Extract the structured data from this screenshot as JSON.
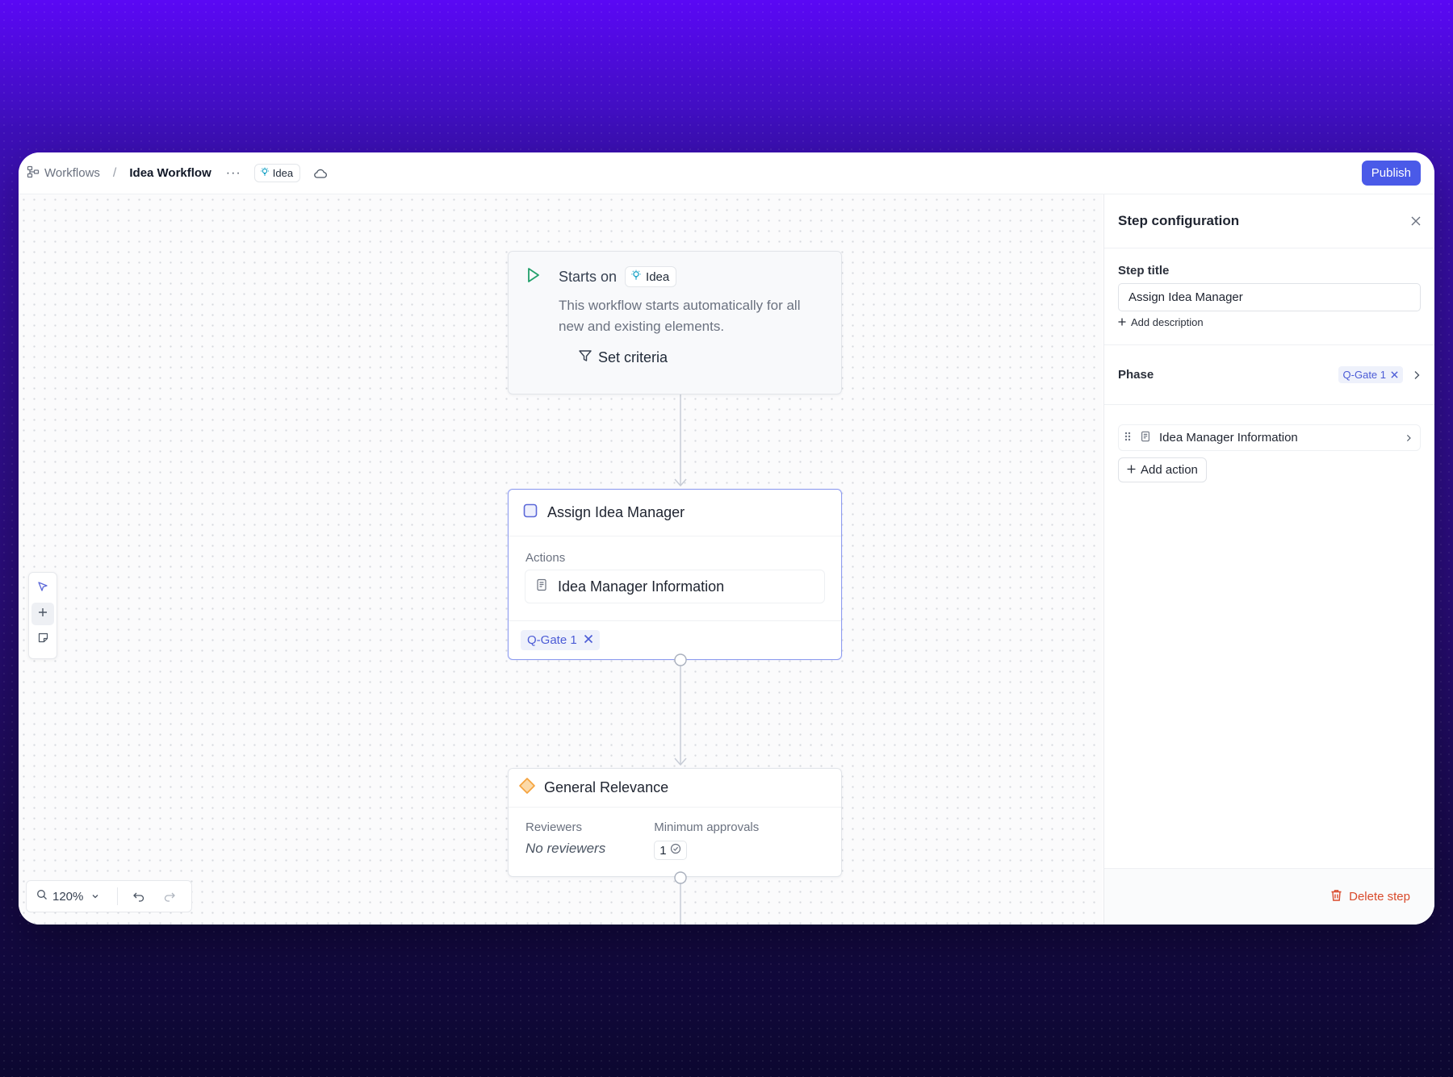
{
  "header": {
    "breadcrumb_root": "Workflows",
    "breadcrumb_separator": "/",
    "breadcrumb_current": "Idea Workflow",
    "more_label": "···",
    "type_label": "Idea",
    "publish_label": "Publish"
  },
  "start_node": {
    "title": "Starts on",
    "chip_label": "Idea",
    "description": "This workflow starts automatically for all new and existing elements.",
    "criteria_label": "Set criteria"
  },
  "assign_node": {
    "title": "Assign Idea Manager",
    "actions_label": "Actions",
    "action_item": "Idea Manager Information",
    "gate_label": "Q-Gate 1"
  },
  "relevance_node": {
    "title": "General Relevance",
    "reviewers_label": "Reviewers",
    "reviewers_value": "No reviewers",
    "approvals_label": "Minimum approvals",
    "approvals_value": "1"
  },
  "zoom": {
    "level": "120%"
  },
  "panel": {
    "title": "Step configuration",
    "step_title_label": "Step title",
    "step_title_value": "Assign Idea Manager",
    "add_description_label": "Add description",
    "phase_label": "Phase",
    "phase_value": "Q-Gate 1",
    "action_item": "Idea Manager Information",
    "add_action_label": "Add action",
    "delete_label": "Delete step"
  },
  "colors": {
    "accent": "#4a5ae8",
    "start_icon": "#22a06b",
    "idea_icon": "#1aa3c6",
    "diamond": "#f5a23c",
    "danger": "#d94a2b"
  }
}
